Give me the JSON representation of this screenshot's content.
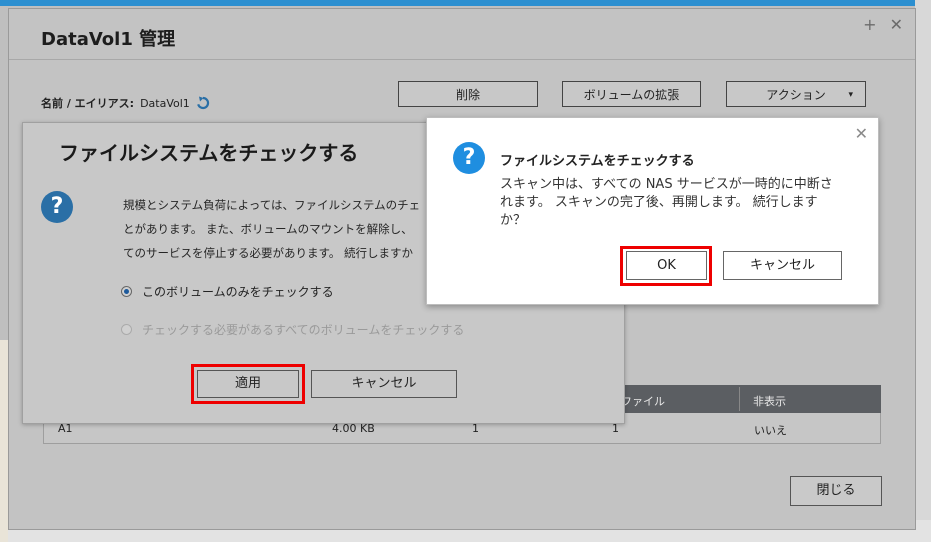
{
  "window": {
    "title": "DataVol1 管理",
    "controls": "+ ✕",
    "alias_label": "名前 / エイリアス:",
    "alias_value": "DataVol1",
    "buttons": {
      "delete": "削除",
      "extend": "ボリュームの拡張",
      "action": "アクション"
    },
    "table": {
      "headers": [
        "ファイル",
        "非表示"
      ],
      "row": [
        "A1",
        "4.00 KB",
        "1",
        "1",
        "いいえ"
      ]
    },
    "close_label": "閉じる"
  },
  "dialog1": {
    "title": "ファイルシステムをチェックする",
    "message_lines": [
      "規模とシステム負荷によっては、ファイルシステムのチェ",
      "とがあります。 また、ボリュームのマウントを解除し、",
      "てのサービスを停止する必要があります。 続行しますか"
    ],
    "option1": "このボリュームのみをチェックする",
    "option2": "チェックする必要があるすべてのボリュームをチェックする",
    "apply_label": "適用",
    "cancel_label": "キャンセル"
  },
  "dialog2": {
    "title": "ファイルシステムをチェックする",
    "message": "スキャン中は、すべての NAS サービスが一時的に中断されます。 スキャンの完了後、再開します。 続行しますか？",
    "ok_label": "OK",
    "cancel_label": "キャンセル",
    "close_glyph": "✕"
  },
  "icons": {
    "question": "?",
    "caret": "▾"
  },
  "colors": {
    "highlight": "#e00000",
    "question_icon": "#1f8ee0",
    "table_header": "#5b5e62"
  }
}
